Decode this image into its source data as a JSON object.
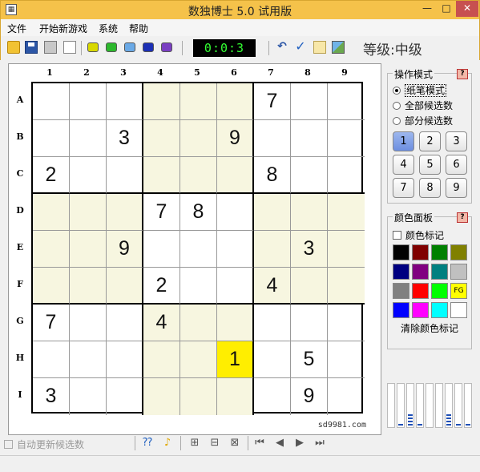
{
  "window": {
    "title": "数独博士 5.0 试用版",
    "min": "—",
    "max": "□",
    "close": "✕"
  },
  "menu": [
    "文件",
    "开始新游戏",
    "系统",
    "帮助"
  ],
  "toolbar": {
    "timer": "0:0:3",
    "level": "等级:中级",
    "dot_colors": [
      "#d8d800",
      "#2db82d",
      "#6aa9e6",
      "#1c2fb5",
      "#7a3fc2"
    ]
  },
  "board": {
    "col_labels": [
      "1",
      "2",
      "3",
      "4",
      "5",
      "6",
      "7",
      "8",
      "9"
    ],
    "row_labels": [
      "A",
      "B",
      "C",
      "D",
      "E",
      "F",
      "G",
      "H",
      "I"
    ],
    "rows": [
      [
        "",
        "",
        "",
        "",
        "",
        "",
        "7",
        "",
        ""
      ],
      [
        "",
        "",
        "3",
        "",
        "",
        "9",
        "",
        "",
        ""
      ],
      [
        "2",
        "",
        "",
        "",
        "",
        "",
        "8",
        "",
        ""
      ],
      [
        "",
        "",
        "",
        "7",
        "8",
        "",
        "",
        "",
        ""
      ],
      [
        "",
        "",
        "9",
        "",
        "",
        "",
        "",
        "3",
        ""
      ],
      [
        "",
        "",
        "",
        "2",
        "",
        "",
        "4",
        "",
        ""
      ],
      [
        "7",
        "",
        "",
        "4",
        "",
        "",
        "",
        "",
        ""
      ],
      [
        "",
        "",
        "",
        "",
        "",
        "1",
        "",
        "5",
        ""
      ],
      [
        "3",
        "",
        "",
        "",
        "",
        "",
        "",
        "9",
        ""
      ]
    ],
    "highlight_cell": "H6",
    "watermark": "sd9981.com"
  },
  "mode_panel": {
    "title": "操作模式",
    "help": "?",
    "options": [
      "纸笔模式",
      "全部候选数",
      "部分候选数"
    ],
    "selected_option": "纸笔模式",
    "digits": [
      "1",
      "2",
      "3",
      "4",
      "5",
      "6",
      "7",
      "8",
      "9"
    ],
    "active_digit": "1"
  },
  "color_panel": {
    "title": "颜色面板",
    "help": "?",
    "checkbox_label": "颜色标记",
    "swatches": [
      "#000000",
      "#800000",
      "#008000",
      "#808000",
      "#000080",
      "#800080",
      "#008080",
      "#c0c0c0",
      "#808080",
      "#ff0000",
      "#00ff00",
      "#ffff00",
      "#0000ff",
      "#ff00ff",
      "#00ffff",
      "#ffffff"
    ],
    "fg_label": "FG",
    "clear_label": "清除颜色标记"
  },
  "candidate_meter_levels": [
    0,
    1,
    4,
    1,
    0,
    0,
    4,
    1,
    1
  ],
  "status": {
    "auto_update_label": "自动更新候选数"
  }
}
